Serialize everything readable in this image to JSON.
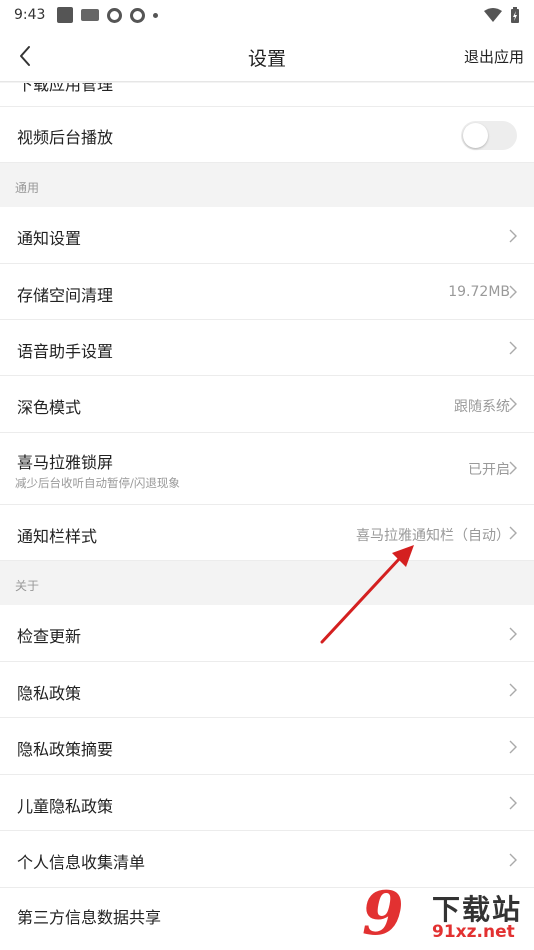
{
  "status_bar": {
    "time": "9:43"
  },
  "header": {
    "title": "设置",
    "exit_label": "退出应用"
  },
  "partial_row": {
    "label": "下载应用管理"
  },
  "video_row": {
    "label": "视频后台播放",
    "toggle_on": false
  },
  "sections": {
    "general": "通用",
    "about": "关于"
  },
  "general_rows": [
    {
      "label": "通知设置",
      "value": ""
    },
    {
      "label": "存储空间清理",
      "value": "19.72MB"
    },
    {
      "label": "语音助手设置",
      "value": ""
    },
    {
      "label": "深色模式",
      "value": "跟随系统"
    },
    {
      "label": "喜马拉雅锁屏",
      "subtitle": "减少后台收听自动暂停/闪退现象",
      "value": "已开启"
    },
    {
      "label": "通知栏样式",
      "value": "喜马拉雅通知栏（自动）"
    }
  ],
  "about_rows": [
    {
      "label": "检查更新"
    },
    {
      "label": "隐私政策"
    },
    {
      "label": "隐私政策摘要"
    },
    {
      "label": "儿童隐私政策"
    },
    {
      "label": "个人信息收集清单"
    },
    {
      "label": "第三方信息数据共享"
    }
  ],
  "watermark": {
    "logo_digit": "9",
    "brand": "下载站",
    "url": "91xz.net"
  },
  "colors": {
    "annotation_arrow": "#d42020",
    "watermark_red": "#e23131"
  }
}
